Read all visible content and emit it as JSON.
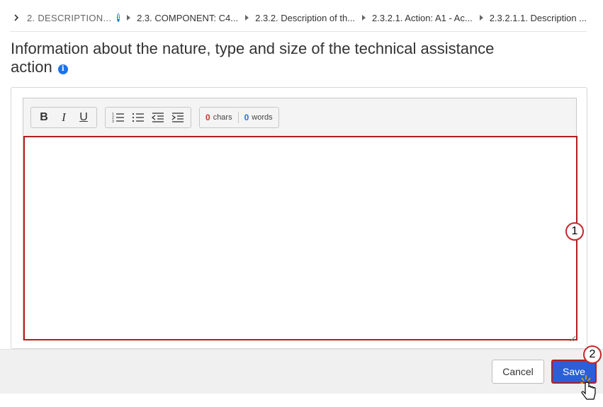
{
  "breadcrumb": {
    "items": [
      "2. DESCRIPTION...",
      "2.3. COMPONENT: C4...",
      "2.3.2. Description of th...",
      "2.3.2.1. Action: A1 - Ac...",
      "2.3.2.1.1. Description ..."
    ]
  },
  "page": {
    "title": "Information about the nature, type and size of the technical assistance action"
  },
  "editor": {
    "toolbar": {
      "bold": "B",
      "italic": "I",
      "underline": "U"
    },
    "counter": {
      "chars_value": "0",
      "chars_label": "chars",
      "words_value": "0",
      "words_label": "words"
    },
    "content": ""
  },
  "callouts": {
    "one": "1",
    "two": "2"
  },
  "footer": {
    "cancel_label": "Cancel",
    "save_label": "Save"
  },
  "colors": {
    "accent": "#2b5ed8",
    "highlight_border": "#b21e1e",
    "info": "#1a73e8",
    "chars_count": "#c0392b",
    "words_count": "#1a73e8"
  }
}
